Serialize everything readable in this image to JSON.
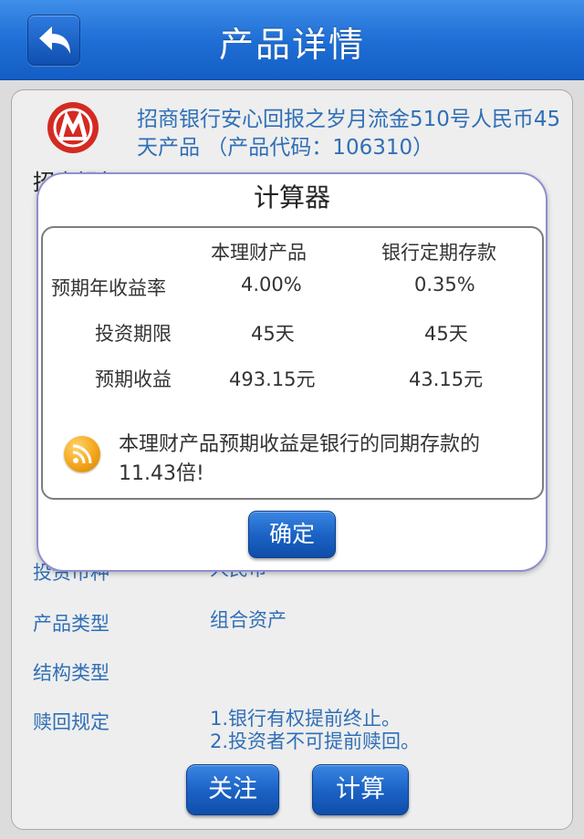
{
  "header": {
    "title": "产品详情",
    "back_icon": "back-arrow-icon"
  },
  "product": {
    "logo_icon": "cmb-bank-logo-icon",
    "name": "招商银行安心回报之岁月流金510号人民币45天产品 （产品代码：106310）",
    "bank_name": "招商银行"
  },
  "details": {
    "currency_label": "投资币种",
    "currency_value": "人民币",
    "type_label": "产品类型",
    "type_value": "组合资产",
    "structure_label": "结构类型",
    "structure_value": "",
    "redeem_label": "赎回规定",
    "redeem_value_1": "1.银行有权提前终止。",
    "redeem_value_2": "2.投资者不可提前赎回。"
  },
  "buttons": {
    "follow": "关注",
    "calculate": "计算"
  },
  "dialog": {
    "title": "计算器",
    "col_product": "本理财产品",
    "col_deposit": "银行定期存款",
    "rows": [
      {
        "label": "预期年收益率",
        "product": "4.00%",
        "deposit": "0.35%"
      },
      {
        "label": "投资期限",
        "product": "45天",
        "deposit": "45天"
      },
      {
        "label": "预期收益",
        "product": "493.15元",
        "deposit": "43.15元"
      }
    ],
    "note_icon": "rss-feed-icon",
    "note": "本理财产品预期收益是银行的同期存款的11.43倍!",
    "ok_label": "确定"
  },
  "colors": {
    "header_blue": "#1f6fd6",
    "link_blue": "#2f6fb7",
    "dialog_border": "#8e8fcd",
    "logo_red": "#d42a22"
  }
}
